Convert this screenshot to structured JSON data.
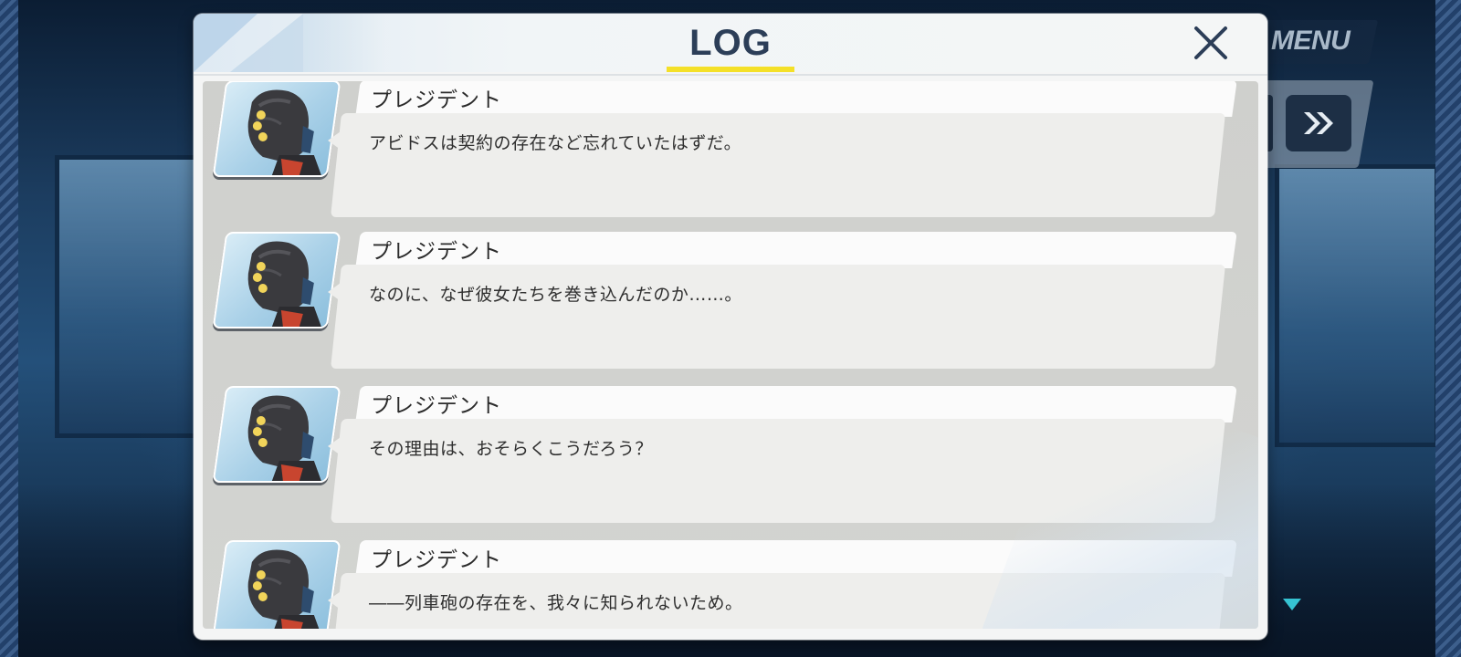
{
  "log": {
    "title": "LOG",
    "entries": [
      {
        "speaker": "プレジデント",
        "text": "アビドスは契約の存在など忘れていたはずだ。"
      },
      {
        "speaker": "プレジデント",
        "text": "なのに、なぜ彼女たちを巻き込んだのか……。"
      },
      {
        "speaker": "プレジデント",
        "text": "その理由は、おそらくこうだろう？"
      },
      {
        "speaker": "プレジデント",
        "text": "――列車砲の存在を、我々に知られないため。"
      }
    ]
  },
  "hud": {
    "menu_label": "MENU"
  },
  "icons": {
    "close": "close-icon",
    "fast_forward": "fast-forward-icon",
    "scroll_down": "triangle-down-icon"
  },
  "colors": {
    "title": "#2c3e58",
    "underline": "#f4e028",
    "background": "#0d2238"
  }
}
